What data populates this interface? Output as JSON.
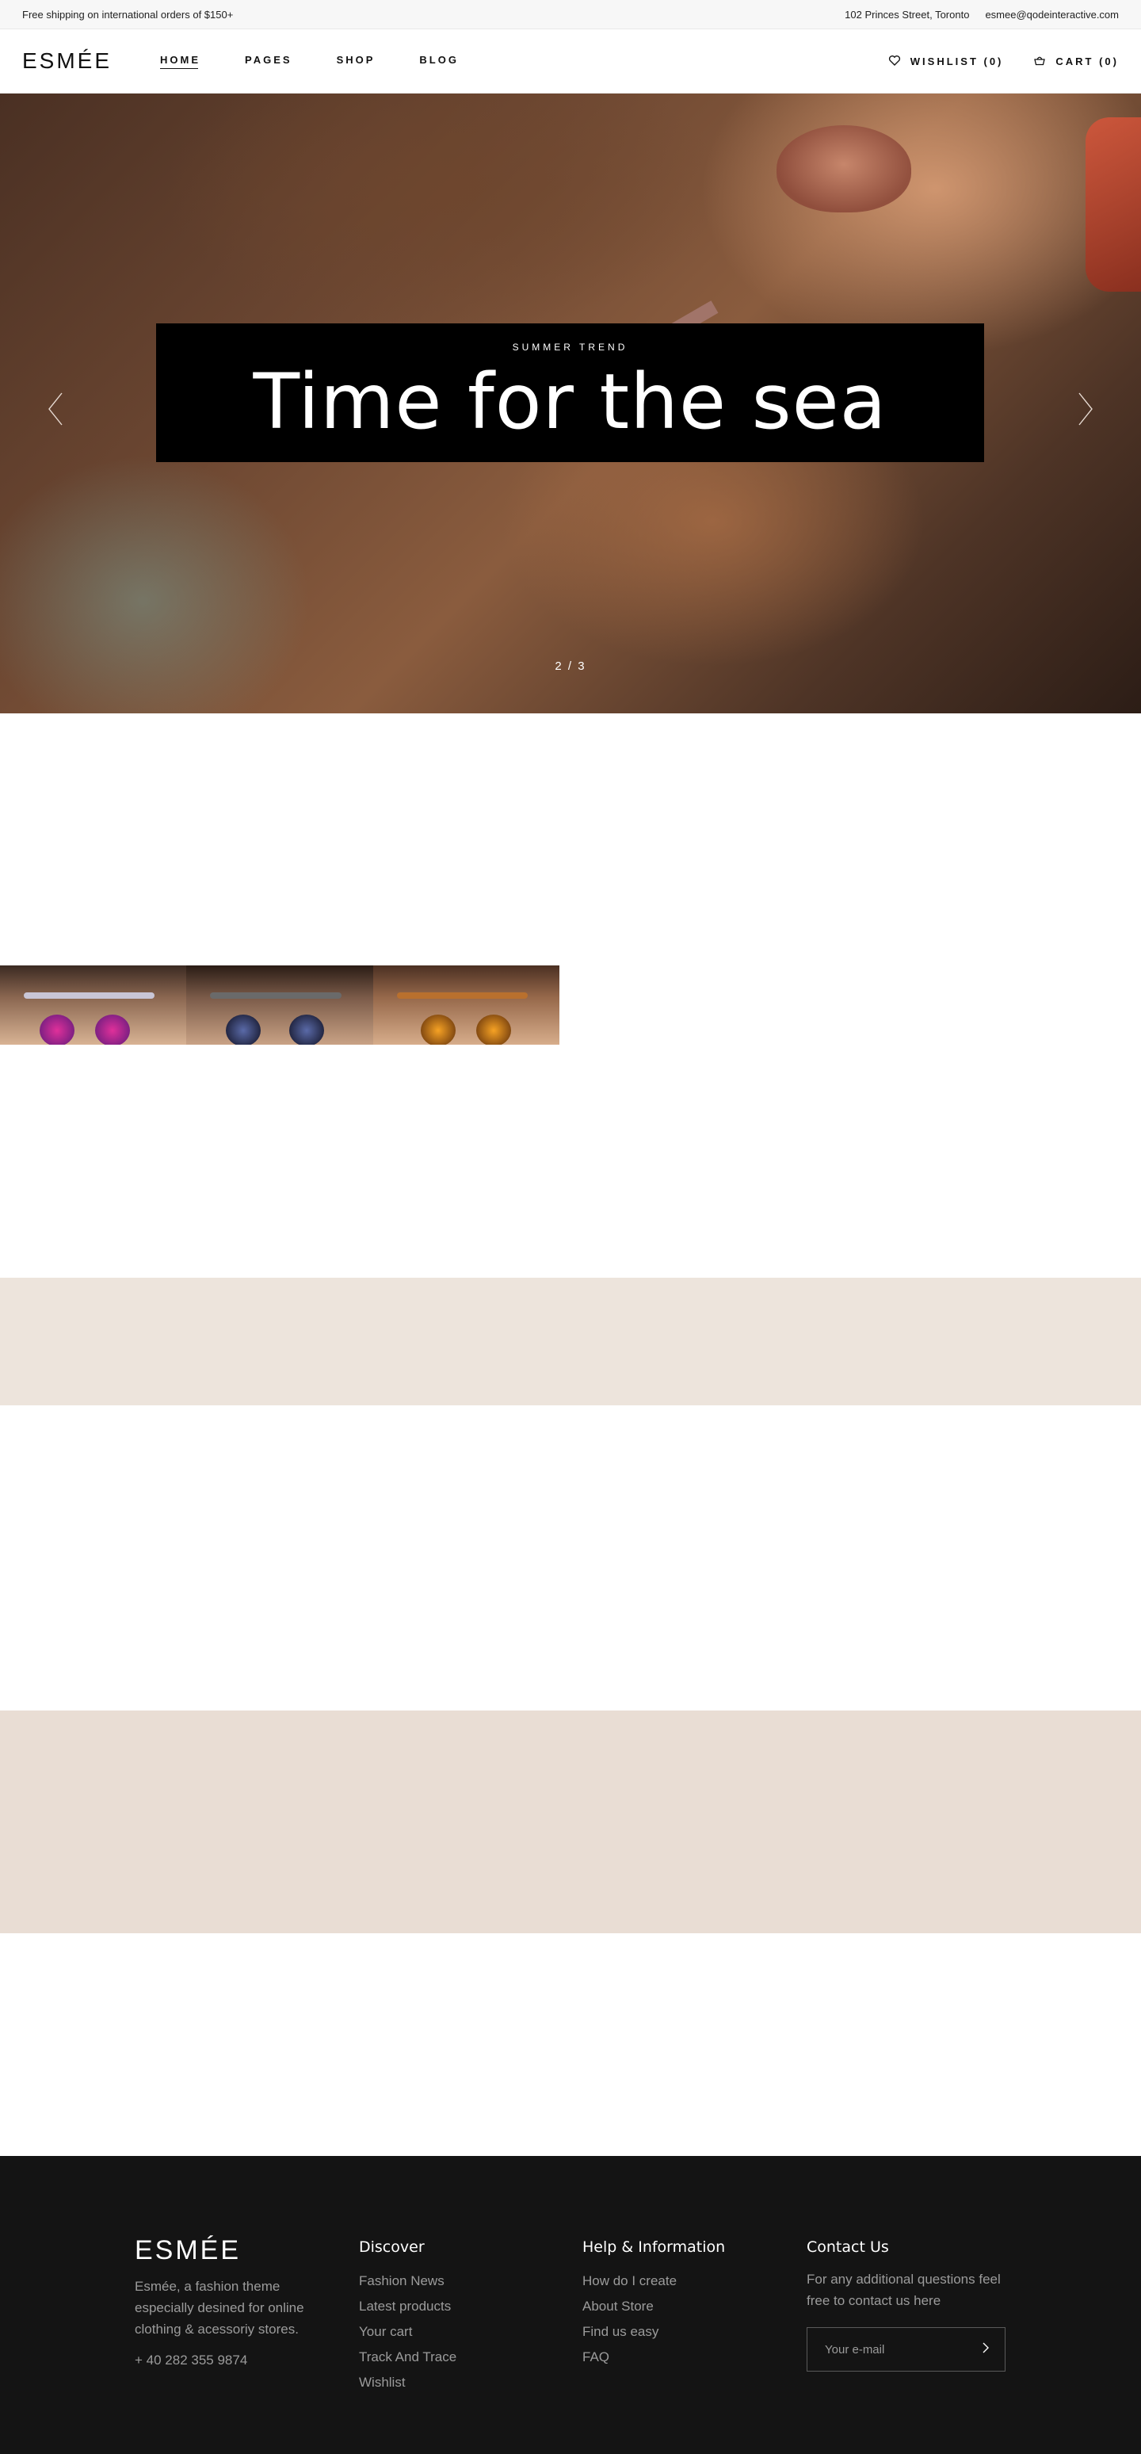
{
  "topbar": {
    "shipping_text": "Free shipping on international orders of $150+",
    "address": "102 Princes Street, Toronto",
    "email": "esmee@qodeinteractive.com"
  },
  "header": {
    "logo": "ESMÉE",
    "nav": [
      {
        "label": "HOME",
        "active": true
      },
      {
        "label": "PAGES",
        "active": false
      },
      {
        "label": "SHOP",
        "active": false
      },
      {
        "label": "BLOG",
        "active": false
      }
    ],
    "wishlist_label": "WISHLIST (0)",
    "cart_label": "CART (0)",
    "icons": {
      "wishlist": "heart-icon",
      "cart": "basket-icon"
    }
  },
  "hero": {
    "kicker": "SUMMER TREND",
    "title": "Time for the sea",
    "counter": "2 / 3",
    "icons": {
      "prev": "chevron-left-icon",
      "next": "chevron-right-icon"
    }
  },
  "colors": {
    "band_light": "#ede4dc",
    "band_medium": "#e9ddd4",
    "footer_bg": "#141414",
    "hero_box": "#000000"
  },
  "footer": {
    "logo": "ESMÉE",
    "description": "Esmée, a fashion theme especially desined for online clothing & acessoriy stores.",
    "phone": "+ 40 282 355 9874",
    "discover": {
      "heading": "Discover",
      "links": [
        "Fashion News",
        "Latest products",
        "Your cart",
        "Track And Trace",
        "Wishlist"
      ]
    },
    "help": {
      "heading": "Help & Information",
      "links": [
        "How do I create",
        "About Store",
        "Find us easy",
        "FAQ"
      ]
    },
    "contact": {
      "heading": "Contact Us",
      "text": "For any additional questions feel free to contact us here",
      "email_placeholder": "Your e-mail",
      "submit_icon": "chevron-right-icon"
    }
  }
}
